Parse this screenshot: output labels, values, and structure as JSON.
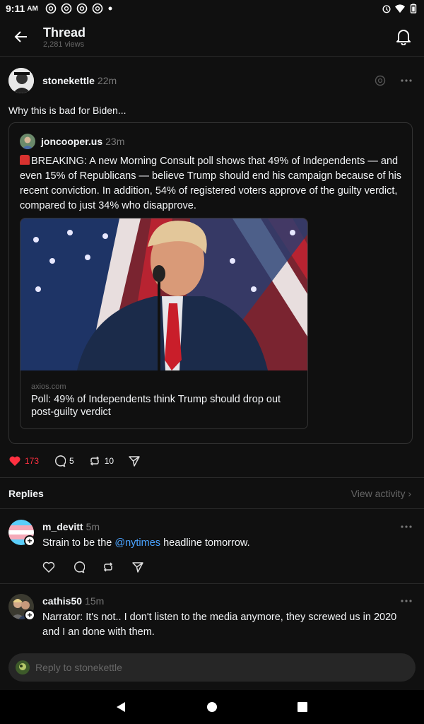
{
  "status_bar": {
    "time": "9:11",
    "ampm": "AM"
  },
  "header": {
    "title": "Thread",
    "views": "2,281 views"
  },
  "post": {
    "author": "stonekettle",
    "ago": "22m",
    "text": "Why this is bad for Biden...",
    "quote": {
      "author": "joncooper.us",
      "ago": "23m",
      "text": "BREAKING: A new Morning Consult poll shows that 49% of Independents — and even 15% of Republicans — believe Trump should end his campaign because of his recent conviction. In addition, 54% of registered voters approve of the guilty verdict, compared to just 34% who disapprove.",
      "link": {
        "domain": "axios.com",
        "headline": "Poll: 49% of Independents think Trump should drop out post-guilty verdict"
      }
    },
    "likes": "173",
    "comments": "5",
    "reposts": "10"
  },
  "replies_section": {
    "label": "Replies",
    "view_activity": "View activity ›"
  },
  "replies": [
    {
      "author": "m_devitt",
      "ago": "5m",
      "text_before": "Strain to be the ",
      "mention": "@nytimes",
      "text_after": " headline tomorrow."
    },
    {
      "author": "cathis50",
      "ago": "15m",
      "text": "Narrator: It's not.. I don't listen to the media anymore, they screwed us in 2020 and I an done with them."
    }
  ],
  "reply_input": {
    "placeholder": "Reply to stonekettle"
  },
  "colors": {
    "background": "#101010",
    "like": "#ff3040",
    "mention": "#4aa3ff",
    "muted": "#777777"
  }
}
